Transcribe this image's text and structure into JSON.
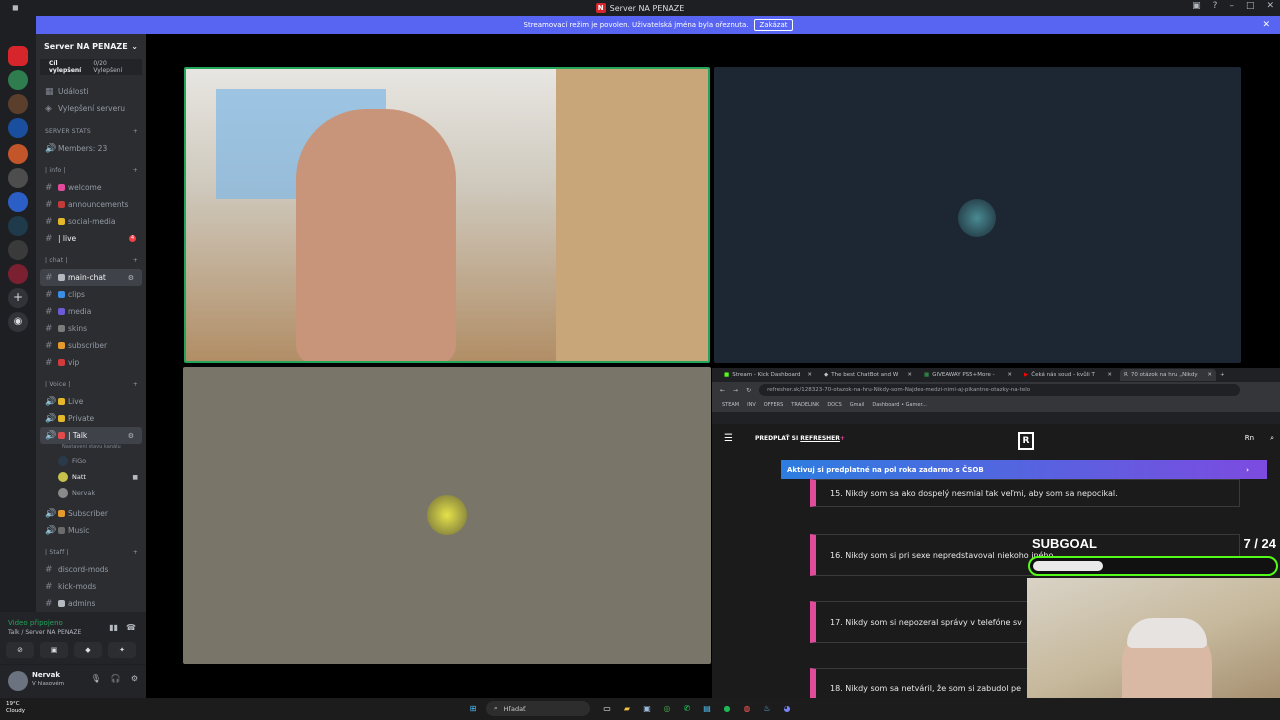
{
  "window": {
    "title": "Server NA PENAZE",
    "logo_letter": "N"
  },
  "banner": {
    "text": "Streamovací režim je povolen. Uživatelská jména byla ořeznuta.",
    "button": "Zakázat"
  },
  "server": {
    "name": "Server NA PENAZE",
    "boost_goal": "Cíl vylepšení",
    "boost_count": "0/20 Vylepšení"
  },
  "nav": [
    {
      "icon": "calendar-icon",
      "label": "Události"
    },
    {
      "icon": "boost-icon",
      "label": "Vylepšení serveru"
    }
  ],
  "categories": {
    "stats": "SERVER STATS",
    "info": "| info |",
    "chat": "| chat |",
    "voice": "| Voice |",
    "staff": "| Staff |"
  },
  "channels": {
    "members": "Members: 23",
    "welcome": "welcome",
    "announcements": "announcements",
    "social": "social-media",
    "live": "| live",
    "live_badge": "4",
    "main_chat": "main-chat",
    "clips": "clips",
    "media": "media",
    "skins": "skins",
    "subscriber": "subscriber",
    "vip": "vip",
    "v_live": "Live",
    "v_private": "Private",
    "v_talk": "| Talk",
    "talk_status": "Nastavení stavu kanálu",
    "v_subscriber": "Subscriber",
    "v_music": "Music",
    "discord_mods": "discord-mods",
    "kick_mods": "kick-mods",
    "admins": "admins"
  },
  "voice_members": [
    "FiGo",
    "Natt",
    "Nervak"
  ],
  "voice_status": {
    "title": "Video připojeno",
    "sub": "Talk / Server NA PENAZE"
  },
  "user": {
    "name": "Nervak",
    "status": "V hlasovém"
  },
  "browser": {
    "tabs": [
      "Stream - Kick Dashboard",
      "The best ChatBot and W",
      "GIVEAWAY PS5+More -",
      "Čeká nás soud - kvůli T",
      "70 otázok na hru „Nikdy"
    ],
    "url": "refresher.sk/128323-70-otazok-na-hru-Nikdy-som-Najdes-medzi-nimi-aj-pikantne-otazky-na-telo",
    "bookmarks": [
      "STEAM",
      "INV",
      "OFFERS",
      "TRADELINK",
      "DOCS",
      "Gmail",
      "Dashboard • Gamer..."
    ],
    "site_label": "PREDPLAŤ SI ",
    "site_brand": "REFRESHER",
    "site_plus": "+",
    "logo": "R",
    "lang": "Rn",
    "promo": "Aktivuj si predplatné na pol roka zadarmo s ČSOB",
    "questions": [
      "15. Nikdy som sa ako dospelý nesmial tak veľmi, aby som sa nepocikal.",
      "16. Nikdy som si pri sexe nepredstavoval niekoho iného.",
      "17. Nikdy som si nepozeral správy v telefóne sv",
      "18. Nikdy som sa netváril, že som si zabudol pe"
    ]
  },
  "subgoal": {
    "label": "SUBGOAL",
    "count": "7 / 24",
    "current": 7,
    "target": 24
  },
  "taskbar": {
    "temp": "19°C",
    "weather": "Cloudy",
    "search": "Hľadať"
  }
}
